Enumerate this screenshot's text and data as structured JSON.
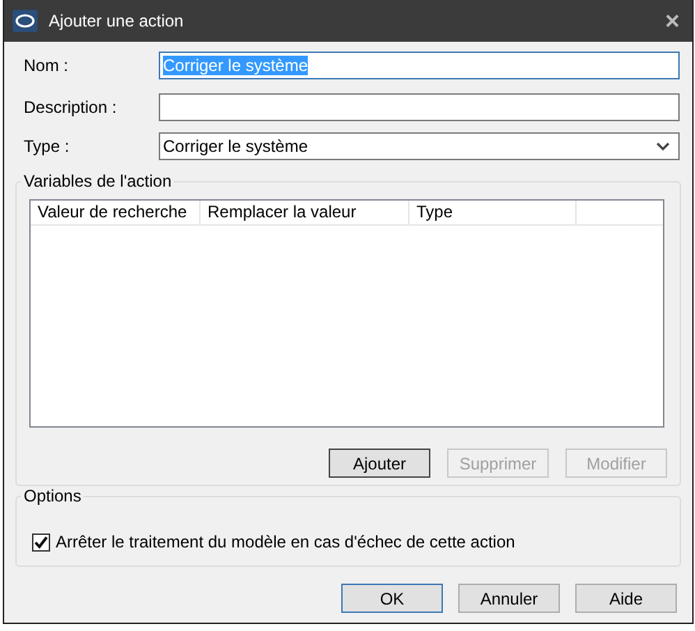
{
  "window": {
    "title": "Ajouter une action",
    "close": "×"
  },
  "fields": [
    {
      "label": "Nom :",
      "value": "Corriger le système",
      "kind": "text",
      "focused": true
    },
    {
      "label": "Description :",
      "kind": "text",
      "focused": false
    },
    {
      "label": "Type :",
      "value": "Corriger le système",
      "kind": "dropdown",
      "focused": false
    }
  ],
  "variables": {
    "title": "Variables de l'action",
    "columns": [
      "Valeur de recherche",
      "Remplacer la valeur",
      "Type"
    ],
    "buttons": [
      {
        "label": "Ajouter",
        "disabled": false
      },
      {
        "label": "Supprimer",
        "disabled": true
      },
      {
        "label": "Modifier",
        "disabled": true
      }
    ]
  },
  "options": {
    "title": "Options",
    "checkbox": {
      "label": "Arrêter le traitement du modèle en cas d'échec de cette action",
      "checked": true
    }
  },
  "buttons": [
    {
      "label": "OK",
      "default": true
    },
    {
      "label": "Annuler",
      "default": false
    },
    {
      "label": "Aide",
      "default": false
    }
  ]
}
